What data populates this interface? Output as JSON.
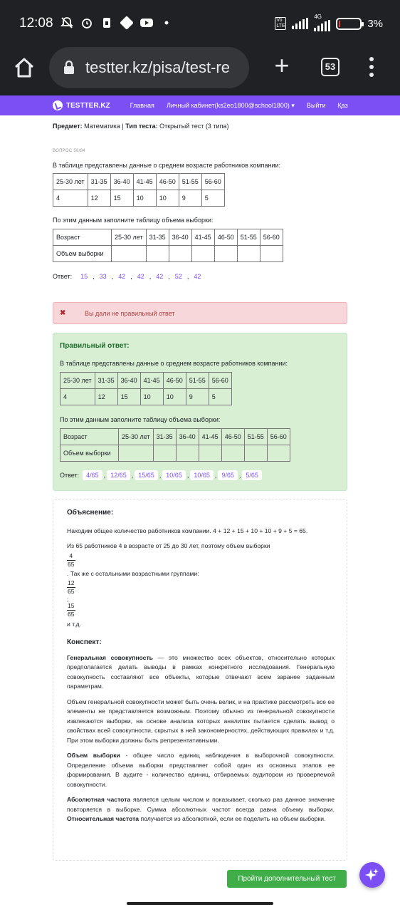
{
  "status": {
    "time": "12:08",
    "network": "4G",
    "volte": "Vo LTE",
    "battery": "3%"
  },
  "browser": {
    "url": "testter.kz/pisa/test-re",
    "tab_count": "53"
  },
  "nav": {
    "logo": "TESTTER.KZ",
    "items": [
      "Главная",
      "Личный кабинет(ks2eo1800@school1800) ▾",
      "Выйти",
      "Қаз"
    ]
  },
  "meta": {
    "subject_label": "Предмет:",
    "subject": "Математика",
    "sep": "|",
    "type_label": "Тип теста:",
    "type": "Открытый тест (3 типа)"
  },
  "question": {
    "number": "ВОПРОС 56/84",
    "text": "В таблице представлены данные о среднем возрасте работников компании:",
    "table1": [
      [
        "25-30 лет",
        "31-35",
        "36-40",
        "41-45",
        "46-50",
        "51-55",
        "56-60"
      ],
      [
        "4",
        "12",
        "15",
        "10",
        "10",
        "9",
        "5"
      ]
    ],
    "text2": "По этим данным заполните таблицу объема выборки:",
    "table2": [
      [
        "Возраст",
        "25-30 лет",
        "31-35",
        "36-40",
        "41-45",
        "46-50",
        "51-55",
        "56-60"
      ],
      [
        "Объем выборки",
        "",
        "",
        "",
        "",
        "",
        "",
        ""
      ]
    ],
    "answer_label": "Ответ:",
    "user_answers": [
      "15",
      "33",
      "42",
      "42",
      "42",
      "52",
      "42"
    ]
  },
  "feedback": {
    "wrong_icon": "✖",
    "wrong_text": "Вы дали не правильный ответ"
  },
  "correct": {
    "title": "Правильный ответ:",
    "text": "В таблице представлены данные о среднем возрасте работников компании:",
    "text2": "По этим данным заполните таблицу объема выборки:",
    "answer_label": "Ответ:",
    "answers": [
      "4/65",
      "12/65",
      "15/65",
      "10/65",
      "10/65",
      "9/65",
      "5/65"
    ]
  },
  "explain": {
    "title": "Объяснение:",
    "p1": "Находим общее количество работников компании. 4 + 12 + 15 + 10 + 10 + 9 + 5 = 65.",
    "p2": "Из 65 работников 4 в возрасте от 25 до 30 лет, поэтому объем выборки",
    "frac1": [
      "4",
      "65"
    ],
    "p3": ". Так же с остальными возрастными группами:",
    "frac2": [
      "12",
      "65"
    ],
    "semi": ";",
    "frac3": [
      "15",
      "65"
    ],
    "p4": "и т.д.",
    "konspekt_title": "Конспект:",
    "k1_bold": "Генеральная совокупность",
    "k1": " — это множество всех объектов, относительно которых предполагается делать выводы в рамках конкретного исследования. Генеральную совокупность составляют все объекты, которые отвечают всем заранее заданным параметрам.",
    "k2": "Объем генеральной совокупности может быть очень велик, и на практике рассмотреть все ее элементы не представляется возможным. Поэтому обычно из генеральной совокупности извлекаются выборки, на основе анализа которых аналитик пытается сделать вывод о свойствах всей совокупности, скрытых в ней закономерностях, действующих правилах и т.д. При этом выборки должны быть репрезентативными.",
    "k3_bold": "Объем выборки",
    "k3": " - общее число единиц наблюдения в выборочной совокупности. Определение объема выборки представляет собой один из основных этапов ее формирования. В аудите - количество единиц, отбираемых аудитором из проверяемой совокупности.",
    "k4_bold": "Абсолютная частота",
    "k4a": " является целым числом и показывает, сколько раз данное значение повторяется в выборке. Сумма абсолютных частот всегда равна объему выборки. ",
    "k4_bold2": "Относительная частота",
    "k4b": " получается из абсолютной, если ее поделить на объем выборки."
  },
  "next_button": "Пройти дополнительный тест"
}
